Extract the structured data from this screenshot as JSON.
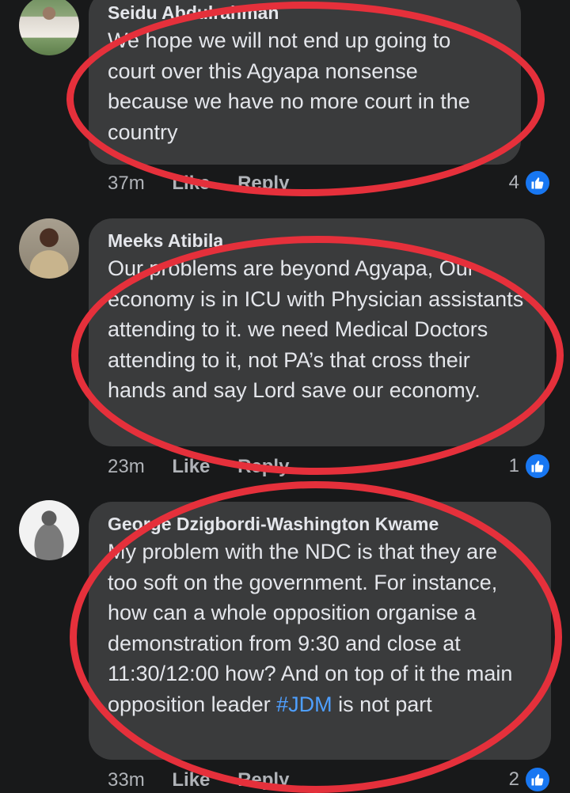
{
  "comments": [
    {
      "author": "Seidu Abdulrahman",
      "text": "We hope we will not end up going to court over this Agyapa nonsense because we have no more court in the country",
      "time": "37m",
      "like_label": "Like",
      "reply_label": "Reply",
      "reaction_count": "4"
    },
    {
      "author": "Meeks Atibila",
      "text": "Our problems are beyond Agyapa, Our economy is in ICU with Physician assistants attending to it. we need Medical Doctors attending to it, not PA’s that cross their hands and say Lord save our economy.",
      "time": "23m",
      "like_label": "Like",
      "reply_label": "Reply",
      "reaction_count": "1"
    },
    {
      "author": "George Dzigbordi-Washington Kwame",
      "text_before": "My problem with the NDC is that they are too soft on the government. For instance, how can a whole opposition organise a demonstration from 9:30 and close at 11:30/12:00 how? And on top of it the main opposition leader ",
      "hashtag": "#JDM",
      "text_after": " is not part",
      "time": "33m",
      "like_label": "Like",
      "reply_label": "Reply",
      "reaction_count": "2"
    }
  ],
  "colors": {
    "background": "#18191a",
    "bubble": "#3a3b3c",
    "annotation": "#e5303b",
    "hashtag": "#4e9fff",
    "like": "#1877f2"
  }
}
